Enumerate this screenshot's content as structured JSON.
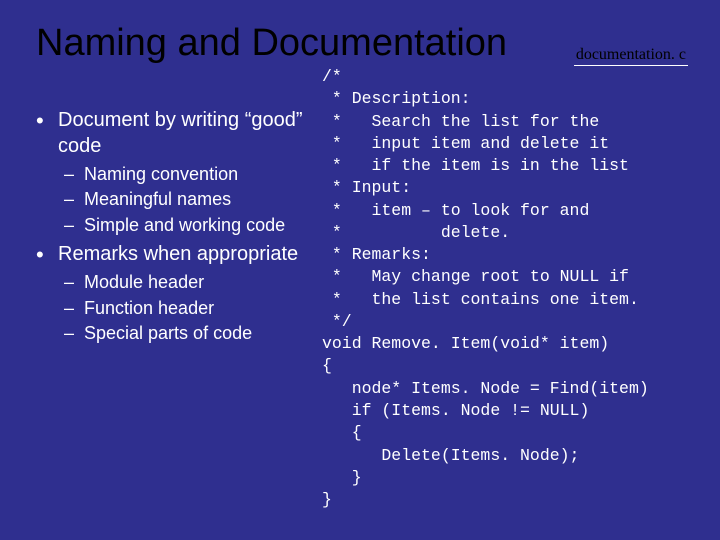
{
  "title": "Naming and Documentation",
  "filename": "documentation. c",
  "bullets": {
    "b1": "Document by writing “good” code",
    "b1s1": "Naming convention",
    "b1s2": "Meaningful names",
    "b1s3": "Simple and working code",
    "b2": "Remarks when appropriate",
    "b2s1": "Module header",
    "b2s2": "Function header",
    "b2s3": "Special parts of code"
  },
  "code": "/*\n * Description:\n *   Search the list for the\n *   input item and delete it\n *   if the item is in the list\n * Input:\n *   item – to look for and\n *          delete.\n * Remarks:\n *   May change root to NULL if\n *   the list contains one item.\n */\nvoid Remove. Item(void* item)\n{\n   node* Items. Node = Find(item)\n   if (Items. Node != NULL)\n   {\n      Delete(Items. Node);\n   }\n}"
}
